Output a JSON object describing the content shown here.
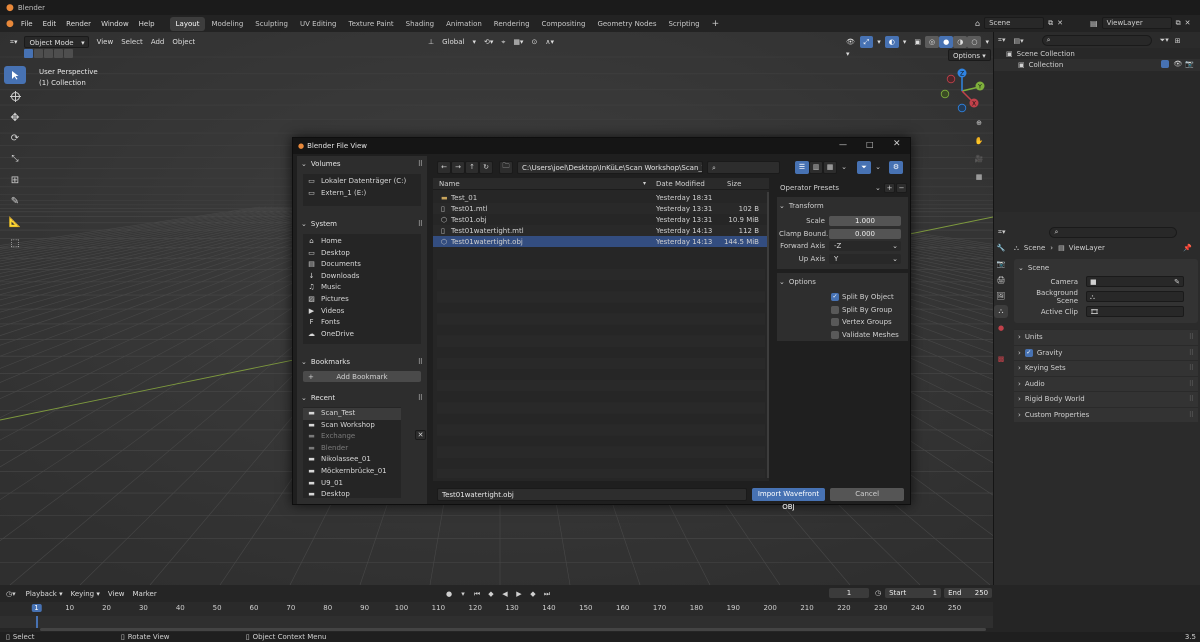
{
  "window": {
    "title": "Blender"
  },
  "menu": [
    "File",
    "Edit",
    "Render",
    "Window",
    "Help"
  ],
  "workspaces": [
    "Layout",
    "Modeling",
    "Sculpting",
    "UV Editing",
    "Texture Paint",
    "Shading",
    "Animation",
    "Rendering",
    "Compositing",
    "Geometry Nodes",
    "Scripting"
  ],
  "active_workspace": "Layout",
  "topright": {
    "scene": "Scene",
    "view_layer": "ViewLayer"
  },
  "viewport_header": {
    "mode": "Object Mode",
    "menus": [
      "View",
      "Select",
      "Add",
      "Object"
    ],
    "orientation": "Global",
    "options": "Options"
  },
  "viewport_overlay": {
    "line1": "User Perspective",
    "line2": "(1) Collection"
  },
  "gizmo": {
    "x": "X",
    "y": "Y",
    "z": "Z"
  },
  "outliner": {
    "scene_collection": "Scene Collection",
    "collection": "Collection"
  },
  "properties": {
    "breadcrumb_scene": "Scene",
    "breadcrumb_layer": "ViewLayer",
    "section": "Scene",
    "camera_label": "Camera",
    "background_label": "Background Scene",
    "clip_label": "Active Clip",
    "panels": [
      "Units",
      "Gravity",
      "Keying Sets",
      "Audio",
      "Rigid Body World",
      "Custom Properties"
    ],
    "gravity_checked": true
  },
  "timeline": {
    "menus": [
      "Playback",
      "Keying",
      "View",
      "Marker"
    ],
    "current_frame": "1",
    "start_label": "Start",
    "start": "1",
    "end_label": "End",
    "end": "250",
    "ticks": [
      "1",
      "10",
      "20",
      "30",
      "40",
      "50",
      "60",
      "70",
      "80",
      "90",
      "100",
      "110",
      "120",
      "130",
      "140",
      "150",
      "160",
      "170",
      "180",
      "190",
      "200",
      "210",
      "220",
      "230",
      "240",
      "250"
    ]
  },
  "statusbar": {
    "select": "Select",
    "rotate": "Rotate View",
    "context": "Object Context Menu",
    "version": "3.5"
  },
  "dialog": {
    "title": "Blender File View",
    "path": "C:\\Users\\joel\\Desktop\\InKüLe\\Scan Workshop\\Scan_Test\\",
    "volumes_title": "Volumes",
    "volumes": [
      "Lokaler Datenträger (C:)",
      "Extern_1 (E:)"
    ],
    "system_title": "System",
    "system": [
      "Home",
      "Desktop",
      "Documents",
      "Downloads",
      "Music",
      "Pictures",
      "Videos",
      "Fonts",
      "OneDrive"
    ],
    "bookmarks_title": "Bookmarks",
    "add_bookmark": "Add Bookmark",
    "recent_title": "Recent",
    "recent": [
      "Scan_Test",
      "Scan Workshop",
      "Exchange",
      "Blender",
      "Nikolassee_01",
      "Möckernbrücke_01",
      "U9_01",
      "Desktop"
    ],
    "columns": {
      "name": "Name",
      "date": "Date Modified",
      "size": "Size"
    },
    "files": [
      {
        "name": "Test_01",
        "date": "Yesterday 18:31",
        "size": "",
        "kind": "folder"
      },
      {
        "name": "Test01.mtl",
        "date": "Yesterday 13:31",
        "size": "102 B",
        "kind": "file"
      },
      {
        "name": "Test01.obj",
        "date": "Yesterday 13:31",
        "size": "10.9 MiB",
        "kind": "mesh"
      },
      {
        "name": "Test01watertight.mtl",
        "date": "Yesterday 14:13",
        "size": "112 B",
        "kind": "file"
      },
      {
        "name": "Test01watertight.obj",
        "date": "Yesterday 14:13",
        "size": "144.5 MiB",
        "kind": "mesh"
      }
    ],
    "selected_file": "Test01watertight.obj",
    "operator_presets": "Operator Presets",
    "transform_title": "Transform",
    "scale_label": "Scale",
    "scale": "1.000",
    "clamp_label": "Clamp Bound...",
    "clamp": "0.000",
    "forward_label": "Forward Axis",
    "forward": "-Z",
    "up_label": "Up Axis",
    "up": "Y",
    "options_title": "Options",
    "options": [
      {
        "label": "Split By Object",
        "checked": true
      },
      {
        "label": "Split By Group",
        "checked": false
      },
      {
        "label": "Vertex Groups",
        "checked": false
      },
      {
        "label": "Validate Meshes",
        "checked": false
      }
    ],
    "filename": "Test01watertight.obj",
    "import_label": "Import Wavefront OBJ",
    "cancel_label": "Cancel"
  },
  "colors": {
    "accent": "#4772b3",
    "x_axis": "#c1414a",
    "y_axis": "#7fb13c",
    "z_axis": "#2f84e3"
  }
}
